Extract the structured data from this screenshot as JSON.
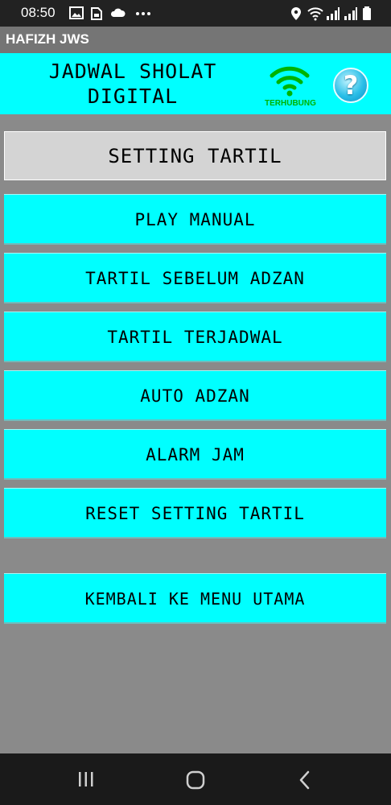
{
  "status_bar": {
    "time": "08:50",
    "icons": [
      "image-icon",
      "sim-icon",
      "cloud-icon",
      "more-dots-icon",
      "location-icon",
      "wifi-status-icon",
      "signal-icon",
      "signal-icon",
      "battery-icon"
    ]
  },
  "app": {
    "title": "HAFIZH JWS"
  },
  "header": {
    "title_line1": "JADWAL SHOLAT",
    "title_line2": "DIGITAL",
    "connection_status": "TERHUBUNG",
    "help_label": "?"
  },
  "section": {
    "title": "SETTING TARTIL"
  },
  "menu": {
    "items": [
      {
        "label": "PLAY MANUAL"
      },
      {
        "label": "TARTIL SEBELUM ADZAN"
      },
      {
        "label": "TARTIL TERJADWAL"
      },
      {
        "label": "AUTO ADZAN"
      },
      {
        "label": "ALARM JAM"
      },
      {
        "label": "RESET SETTING TARTIL"
      }
    ],
    "back_label": "KEMBALI KE MENU UTAMA"
  },
  "colors": {
    "accent": "#00ffff",
    "background": "#8a8a8a",
    "section_header": "#d4d4d4",
    "connected": "#00b300"
  },
  "nav": {
    "icons": [
      "recent-apps-icon",
      "home-icon",
      "back-icon"
    ]
  }
}
